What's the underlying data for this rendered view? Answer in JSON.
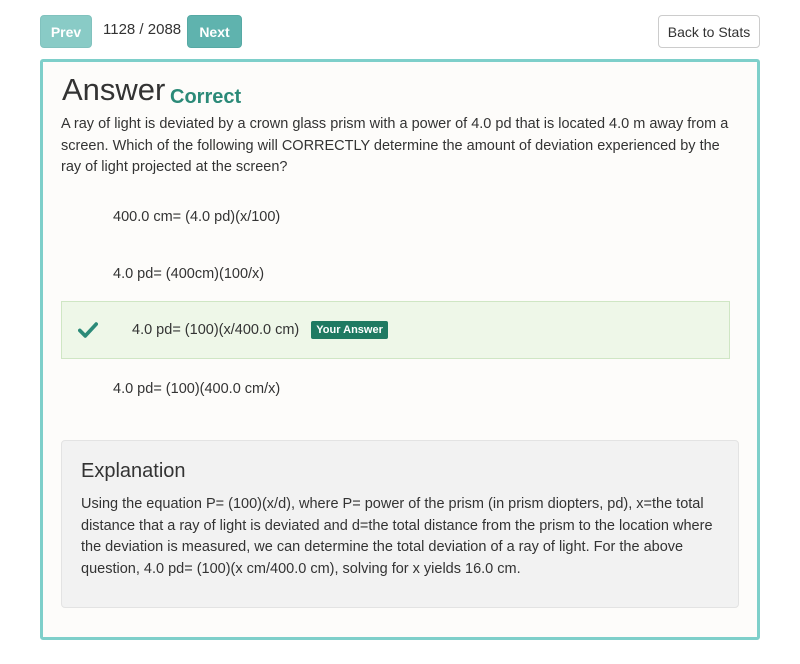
{
  "nav": {
    "prev_label": "Prev",
    "counter": "1128 / 2088",
    "next_label": "Next",
    "back_label": "Back to Stats"
  },
  "answer": {
    "title": "Answer",
    "result": "Correct",
    "question": "A ray of light is deviated by a crown glass prism with a power of 4.0 pd that is located 4.0 m away from a screen. Which of the following will CORRECTLY determine the amount of deviation experienced by the ray of light projected at the screen?",
    "options": [
      {
        "text": "400.0 cm= (4.0 pd)(x/100)",
        "selected": false
      },
      {
        "text": "4.0 pd= (400cm)(100/x)",
        "selected": false
      },
      {
        "text": "4.0 pd= (100)(x/400.0 cm)",
        "selected": true,
        "badge": "Your Answer",
        "icon": "checkmark-icon"
      },
      {
        "text": "4.0 pd= (100)(400.0 cm/x)",
        "selected": false
      }
    ]
  },
  "explanation": {
    "title": "Explanation",
    "body": "Using the equation P= (100)(x/d), where P= power of the prism (in prism diopters, pd), x=the total distance that a ray of light is deviated and d=the total distance from the prism to the location where the deviation is measured, we can determine the total deviation of a ray of light. For the above question, 4.0 pd= (100)(x cm/400.0 cm), solving for x yields 16.0 cm."
  },
  "colors": {
    "accent": "#75c2bd",
    "correct": "#2b8a78",
    "badge": "#1f7a62",
    "selected_bg": "#eef7e8"
  }
}
